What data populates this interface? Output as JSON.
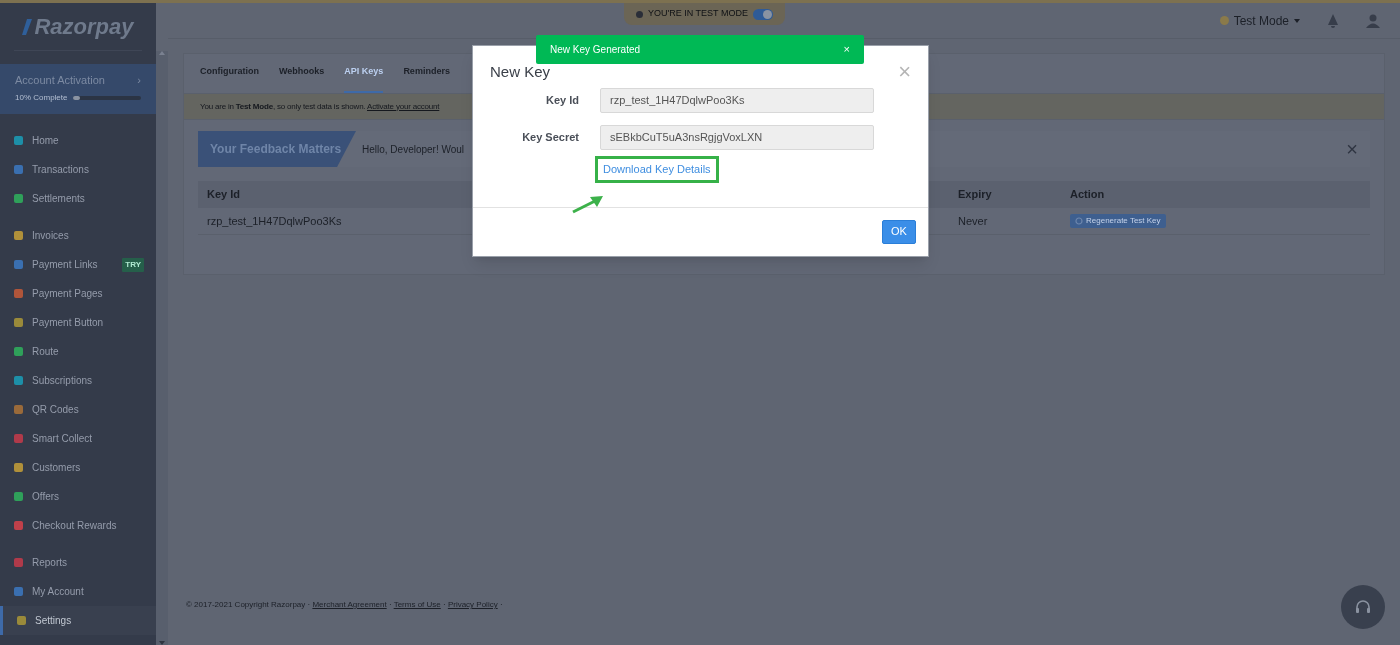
{
  "sidebar": {
    "logo": "Razorpay",
    "activation": {
      "title": "Account Activation",
      "chevron": "›",
      "progress_label": "10% Complete",
      "level": 0.1
    },
    "groups": [
      [
        {
          "label": "Home",
          "color": "#1d8fa8",
          "selected": false
        },
        {
          "label": "Transactions",
          "color": "#3a6fb0",
          "selected": false
        },
        {
          "label": "Settlements",
          "color": "#2fa05a",
          "selected": false
        }
      ],
      [
        {
          "label": "Invoices",
          "color": "#b0903a",
          "selected": false
        },
        {
          "label": "Payment Links",
          "color": "#3a6fb0",
          "selected": false,
          "badge": "TRY"
        },
        {
          "label": "Payment Pages",
          "color": "#b0553a",
          "selected": false
        },
        {
          "label": "Payment Button",
          "color": "#9a8a3a",
          "selected": false
        },
        {
          "label": "Route",
          "color": "#2fa05a",
          "selected": false
        },
        {
          "label": "Subscriptions",
          "color": "#1d8fa8",
          "selected": false
        },
        {
          "label": "QR Codes",
          "color": "#9a6a3a",
          "selected": false
        },
        {
          "label": "Smart Collect",
          "color": "#b03a4a",
          "selected": false
        },
        {
          "label": "Customers",
          "color": "#b0903a",
          "selected": false
        },
        {
          "label": "Offers",
          "color": "#2fa05a",
          "selected": false
        },
        {
          "label": "Checkout Rewards",
          "color": "#c0404a",
          "selected": false
        }
      ],
      [
        {
          "label": "Reports",
          "color": "#b03a4a",
          "selected": false
        },
        {
          "label": "My Account",
          "color": "#3a6fb0",
          "selected": false
        },
        {
          "label": "Settings",
          "color": "#9a8a3a",
          "selected": true
        }
      ]
    ]
  },
  "topbar": {
    "test_banner": "YOU'RE IN TEST MODE",
    "test_toggle_on": true,
    "mode_menu": "Test Mode"
  },
  "tabs": [
    {
      "label": "Configuration",
      "selected": false
    },
    {
      "label": "Webhooks",
      "selected": false
    },
    {
      "label": "API Keys",
      "selected": true
    },
    {
      "label": "Reminders",
      "selected": false
    }
  ],
  "notice": {
    "text": "You are in **Test Mode**, so only test data is shown. ",
    "link": "Activate your account"
  },
  "feedback": {
    "ribbon": "Your Feedback Matters",
    "message": "Hello, Developer! Woul",
    "close": "×"
  },
  "table": {
    "columns": [
      "Key Id",
      "Expiry",
      "Action"
    ],
    "rows": [
      {
        "key_id": "rzp_test_1H47DqlwPoo3Ks",
        "expiry": "Never",
        "action": "Regenerate Test Key"
      }
    ]
  },
  "footer": [
    {
      "kind": "text",
      "text": "© 2017-2021 Copyright Razorpay · "
    },
    {
      "kind": "link",
      "text": "Merchant Agreement"
    },
    {
      "kind": "text",
      "text": " · "
    },
    {
      "kind": "link",
      "text": "Terms of Use"
    },
    {
      "kind": "text",
      "text": " · "
    },
    {
      "kind": "link",
      "text": "Privacy Policy"
    },
    {
      "kind": "text",
      "text": " ·"
    }
  ],
  "toast": {
    "message": "New Key Generated",
    "close": "×"
  },
  "modal": {
    "title": "New Key",
    "close": "×",
    "fields": [
      {
        "label": "Key Id",
        "value": "rzp_test_1H47DqlwPoo3Ks"
      },
      {
        "label": "Key Secret",
        "value": "sEBkbCuT5uA3nsRgjgVoxLXN"
      }
    ],
    "download_link": "Download Key Details",
    "ok": "OK"
  }
}
